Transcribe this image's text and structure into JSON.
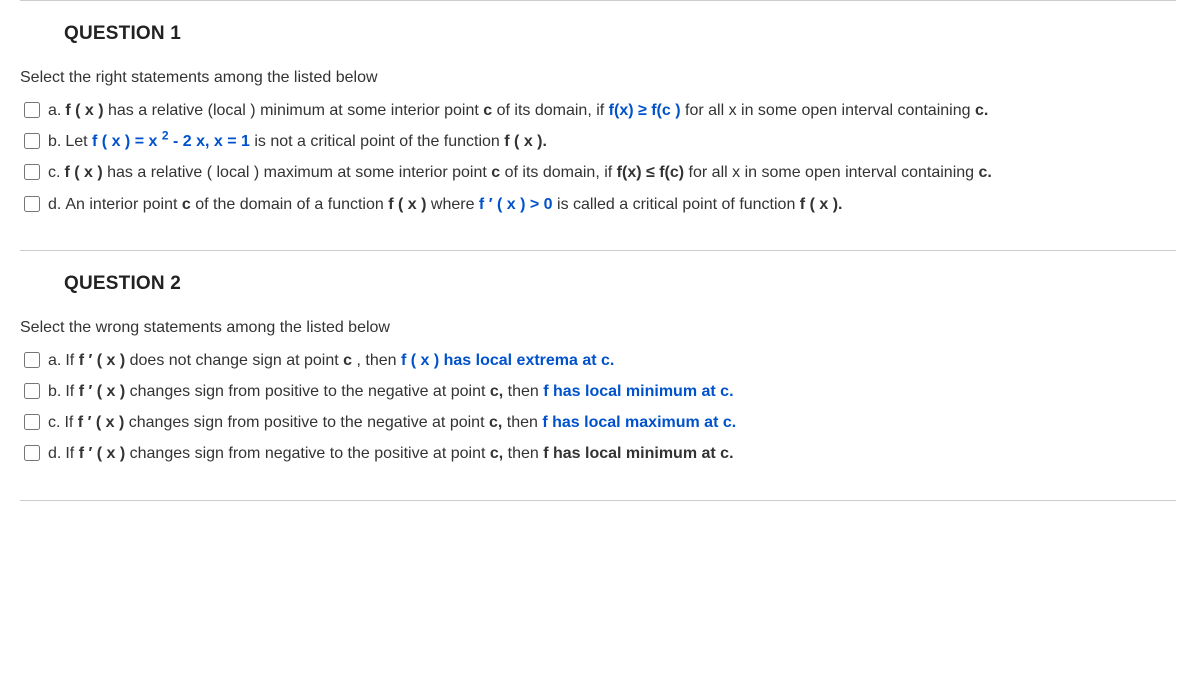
{
  "q1": {
    "title": "QUESTION 1",
    "prompt": "Select the right statements among the listed below",
    "a_label": "a.",
    "a_p1": "f ( x )",
    "a_p2": " has a relative (local ) minimum at some interior point ",
    "a_p3": "c",
    "a_p4": " of its domain, if ",
    "a_p5": "f(x) ≥ f(c )",
    "a_p6": " for all x in some open interval containing ",
    "a_p7": "c.",
    "b_label": "b.",
    "b_p1": "Let ",
    "b_p2": "f ( x ) = x ",
    "b_sup": "2",
    "b_p2b": " - 2 x,  x = 1",
    "b_p3": " is not a critical point of the function ",
    "b_p4": "f ( x ).",
    "c_label": "c.",
    "c_p1": "f ( x )",
    "c_p2": " has a relative ( local ) maximum at some interior point ",
    "c_p3": "c",
    "c_p4": " of its domain,  if  ",
    "c_p5": "f(x) ≤  f(c)",
    "c_p6": " for all x in some open interval containing ",
    "c_p7": "c.",
    "d_label": "d.",
    "d_p1": "An interior point ",
    "d_p2": "c",
    "d_p3": " of the domain of a function ",
    "d_p4": "f ( x )",
    "d_p5": "  where ",
    "d_p6": "f ′ ( x )  > 0",
    "d_p7": " is called a critical point of function ",
    "d_p8": "f ( x )."
  },
  "q2": {
    "title": "QUESTION 2",
    "prompt": "Select the wrong statements among the listed below",
    "a_label": "a.",
    "a_p1": "If  ",
    "a_p2": "f ′ ( x )",
    "a_p3": " does not change sign at point ",
    "a_p4": "c",
    "a_p5": " ,  then ",
    "a_p6": "f ( x ) has local extrema at c.",
    "b_label": "b.",
    "b_p1": "If ",
    "b_p2": "f ′ ( x )",
    "b_p3": " changes sign from positive to the negative at point ",
    "b_p4": "c,",
    "b_p5": " then ",
    "b_p6": "f has local minimum at c.",
    "c_label": "c.",
    "c_p1": "If ",
    "c_p2": "f ′ ( x )",
    "c_p3": " changes sign from positive to the negative at point ",
    "c_p4": "c,",
    "c_p5": " then ",
    "c_p6": "f has local maximum at c.",
    "d_label": "d.",
    "d_p1": "If ",
    "d_p2": "f ′ ( x )",
    "d_p3": " changes sign from negative to the positive at point ",
    "d_p4": "c,",
    "d_p5": " then ",
    "d_p6": "f has local minimum at c."
  }
}
